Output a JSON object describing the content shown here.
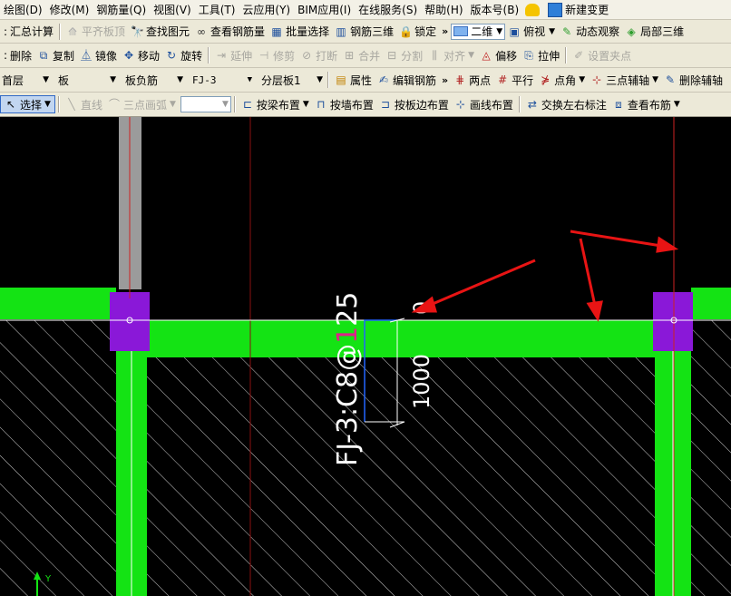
{
  "menu": [
    "绘图(D)",
    "修改(M)",
    "钢筋量(Q)",
    "视图(V)",
    "工具(T)",
    "云应用(Y)",
    "BIM应用(I)",
    "在线服务(S)",
    "帮助(H)",
    "版本号(B)"
  ],
  "menu_extra": "新建变更",
  "toolbar1": {
    "items": [
      "汇总计算",
      "平齐板顶",
      "查找图元",
      "查看钢筋量",
      "批量选择",
      "钢筋三维",
      "锁定"
    ],
    "view_mode": "二维",
    "view_dir": "俯视",
    "dynamic": "动态观察",
    "local3d": "局部三维"
  },
  "toolbar2": [
    "删除",
    "复制",
    "镜像",
    "移动",
    "旋转",
    "延伸",
    "修剪",
    "打断",
    "合并",
    "分割",
    "对齐",
    "偏移",
    "拉伸",
    "设置夹点"
  ],
  "toolbar3": {
    "floor": "首层",
    "category": "板",
    "subtype": "板负筋",
    "element": "FJ-3",
    "layer": "分层板1",
    "props": "属性",
    "edit_rebar": "编辑钢筋",
    "two_point": "两点",
    "parallel": "平行",
    "corner": "点角",
    "three_axis": "三点辅轴",
    "delete_aux": "删除辅轴"
  },
  "toolbar4": {
    "select": "选择",
    "line": "直线",
    "arc": "三点画弧",
    "beam": "按梁布置",
    "wall": "按墙布置",
    "slab_edge": "按板边布置",
    "draw_line": "画线布置",
    "swap": "交换左右标注",
    "view_layout": "查看布筋"
  },
  "canvas": {
    "rebar_label_a": "FJ-3:C8@",
    "rebar_label_highlight": "1",
    "rebar_label_b": "25",
    "dim_left": "0",
    "dim_right": "1000",
    "axis_y": "Y",
    "colors": {
      "beam": "#14e314",
      "column": "#8a18d8",
      "arrow": "#e81414",
      "rebar": "#2266ff",
      "highlight": "#e0208a"
    }
  }
}
